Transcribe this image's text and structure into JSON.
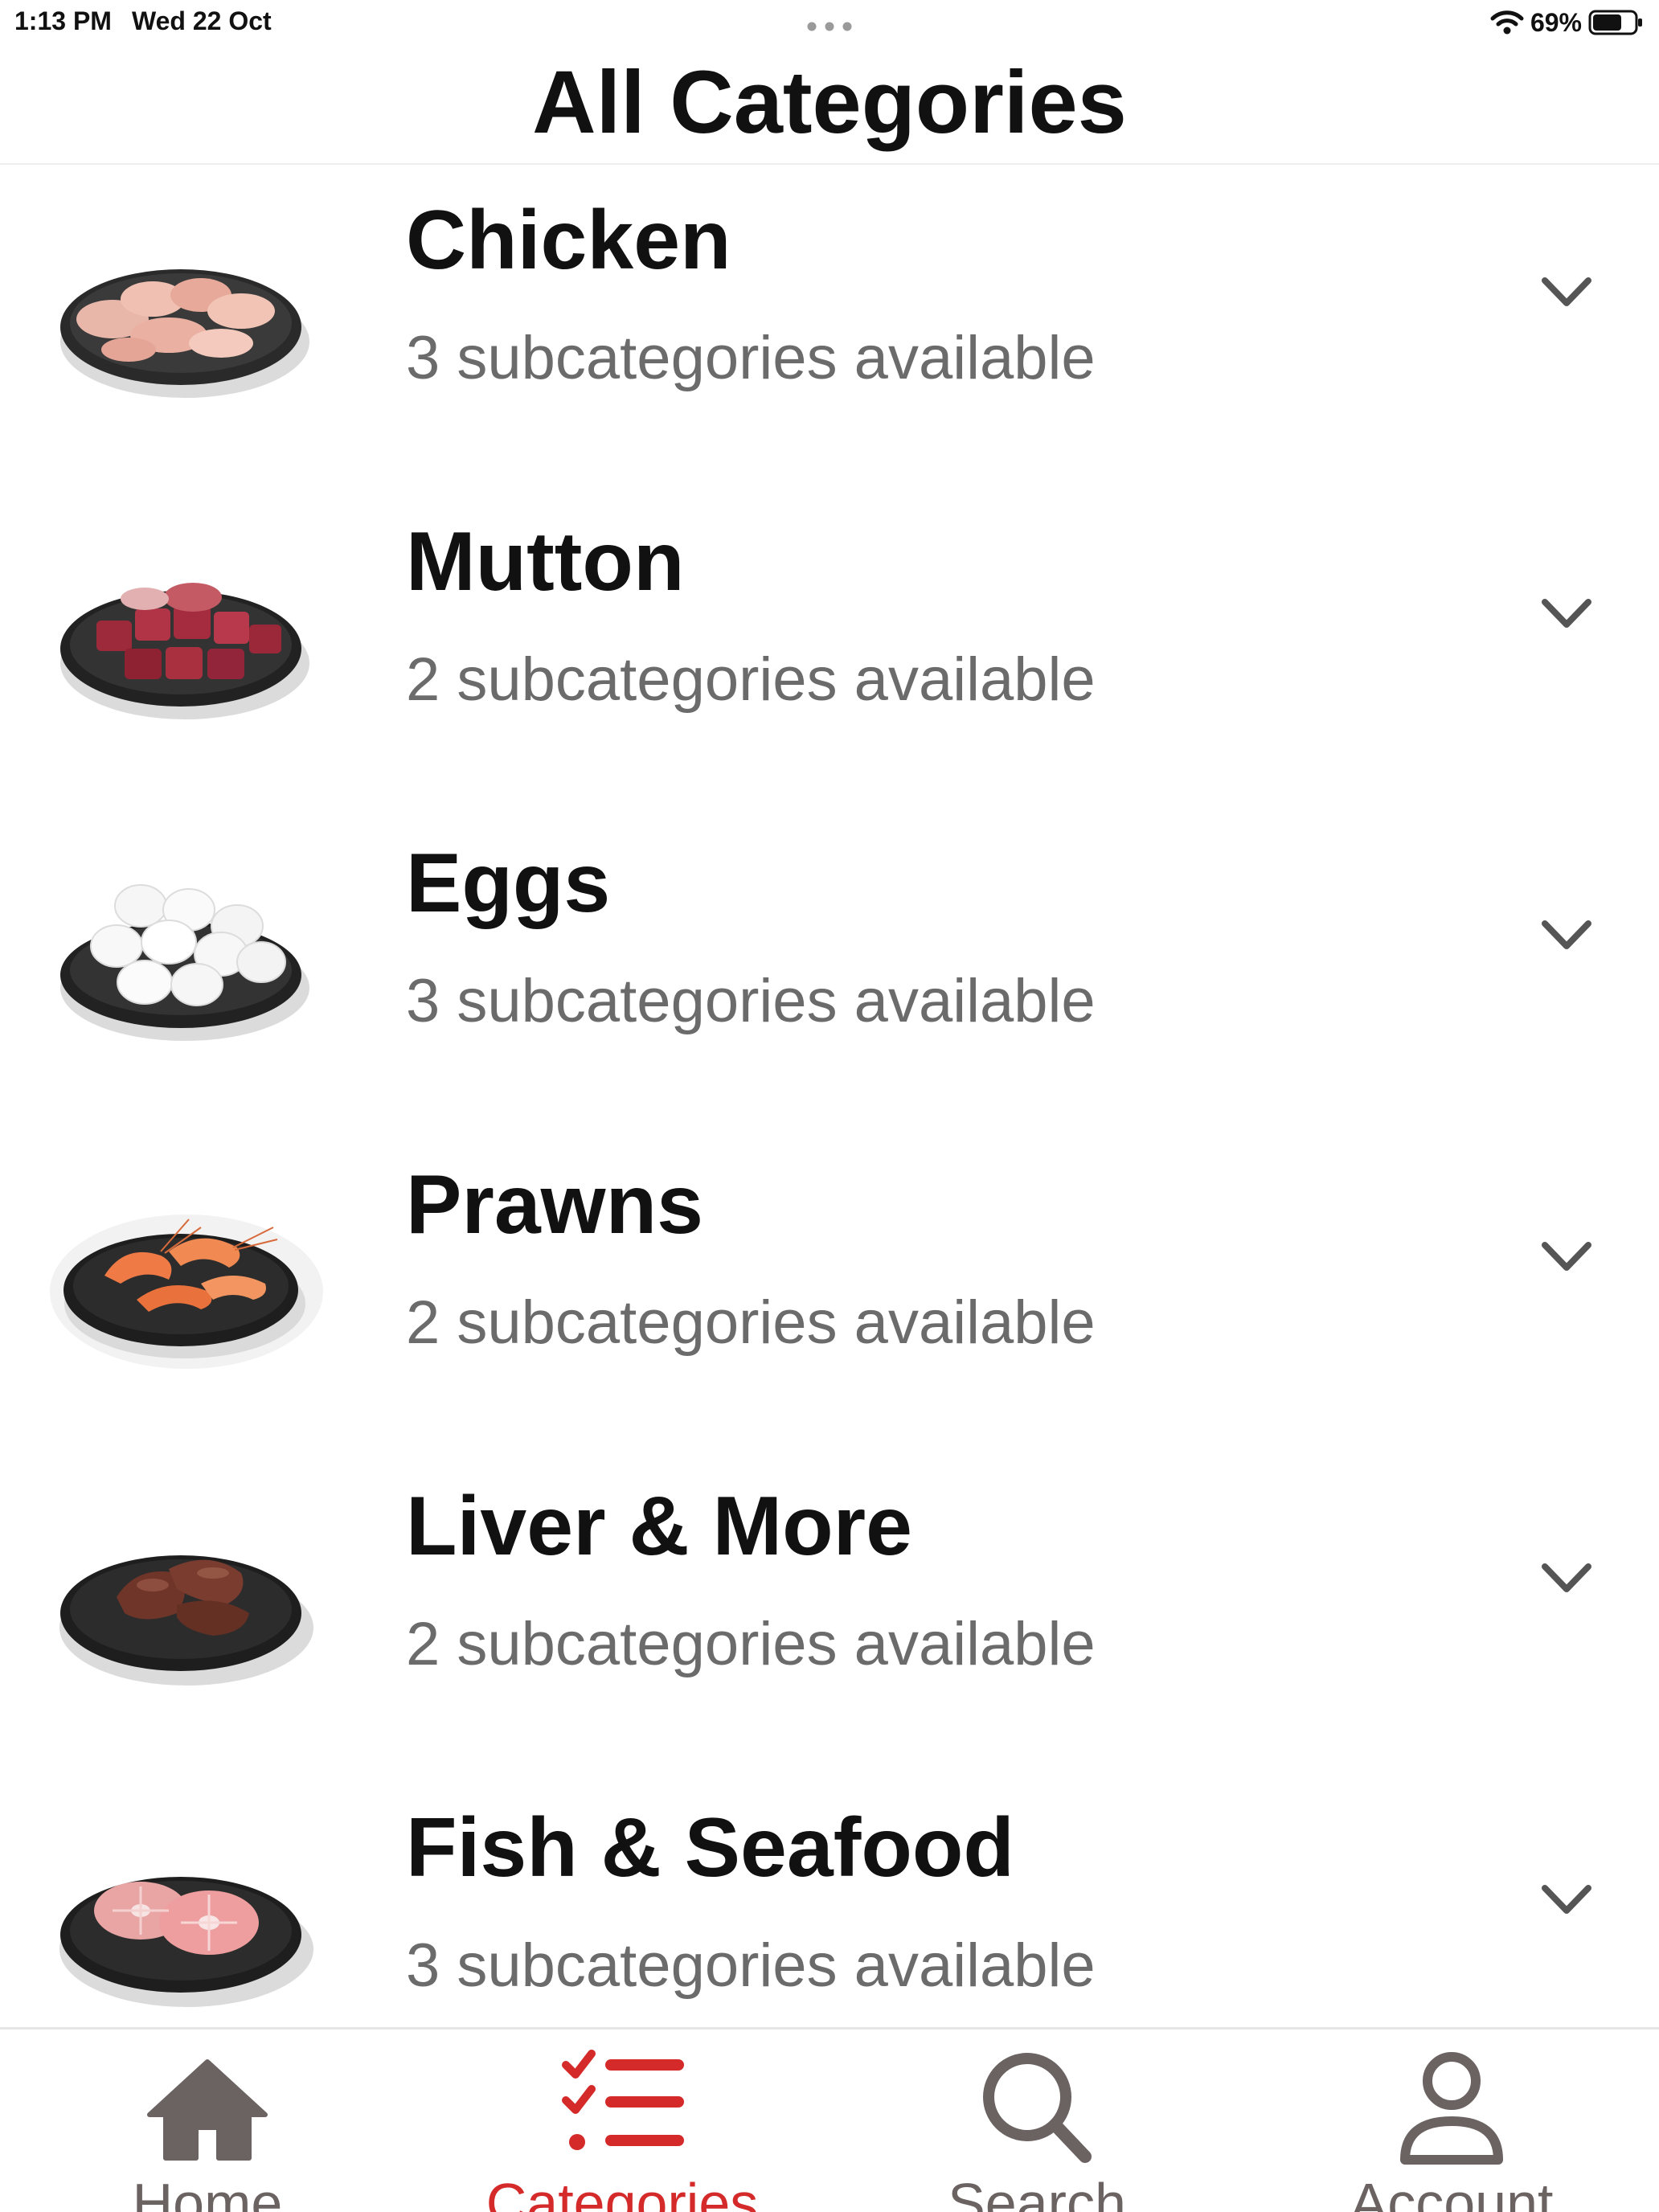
{
  "status_bar": {
    "time": "1:13 PM",
    "date": "Wed 22 Oct",
    "battery_percent": "69%",
    "battery_level": 0.69,
    "icons": [
      "wifi-icon",
      "battery-icon",
      "multitask-dots-icon"
    ]
  },
  "header": {
    "title": "All Categories"
  },
  "categories": [
    {
      "name": "Chicken",
      "subtitle": "3 subcategories available",
      "image": "chicken-plate",
      "chevron": "chevron-down-icon"
    },
    {
      "name": "Mutton",
      "subtitle": "2 subcategories available",
      "image": "mutton-plate",
      "chevron": "chevron-down-icon"
    },
    {
      "name": "Eggs",
      "subtitle": "3 subcategories available",
      "image": "eggs-plate",
      "chevron": "chevron-down-icon"
    },
    {
      "name": "Prawns",
      "subtitle": "2 subcategories available",
      "image": "prawns-plate",
      "chevron": "chevron-down-icon"
    },
    {
      "name": "Liver & More",
      "subtitle": "2 subcategories available",
      "image": "liver-plate",
      "chevron": "chevron-down-icon"
    },
    {
      "name": "Fish & Seafood",
      "subtitle": "3 subcategories available",
      "image": "fish-plate",
      "chevron": "chevron-down-icon"
    }
  ],
  "tab_bar": {
    "tabs": [
      {
        "label": "Home",
        "icon": "home-icon",
        "active": false
      },
      {
        "label": "Categories",
        "icon": "checklist-icon",
        "active": true
      },
      {
        "label": "Search",
        "icon": "search-icon",
        "active": false
      },
      {
        "label": "Account",
        "icon": "person-icon",
        "active": false
      }
    ]
  },
  "colors": {
    "accent": "#d42a2a",
    "inactive_tab": "#6b6262",
    "subtitle": "#6b6b6b",
    "title": "#111111"
  }
}
